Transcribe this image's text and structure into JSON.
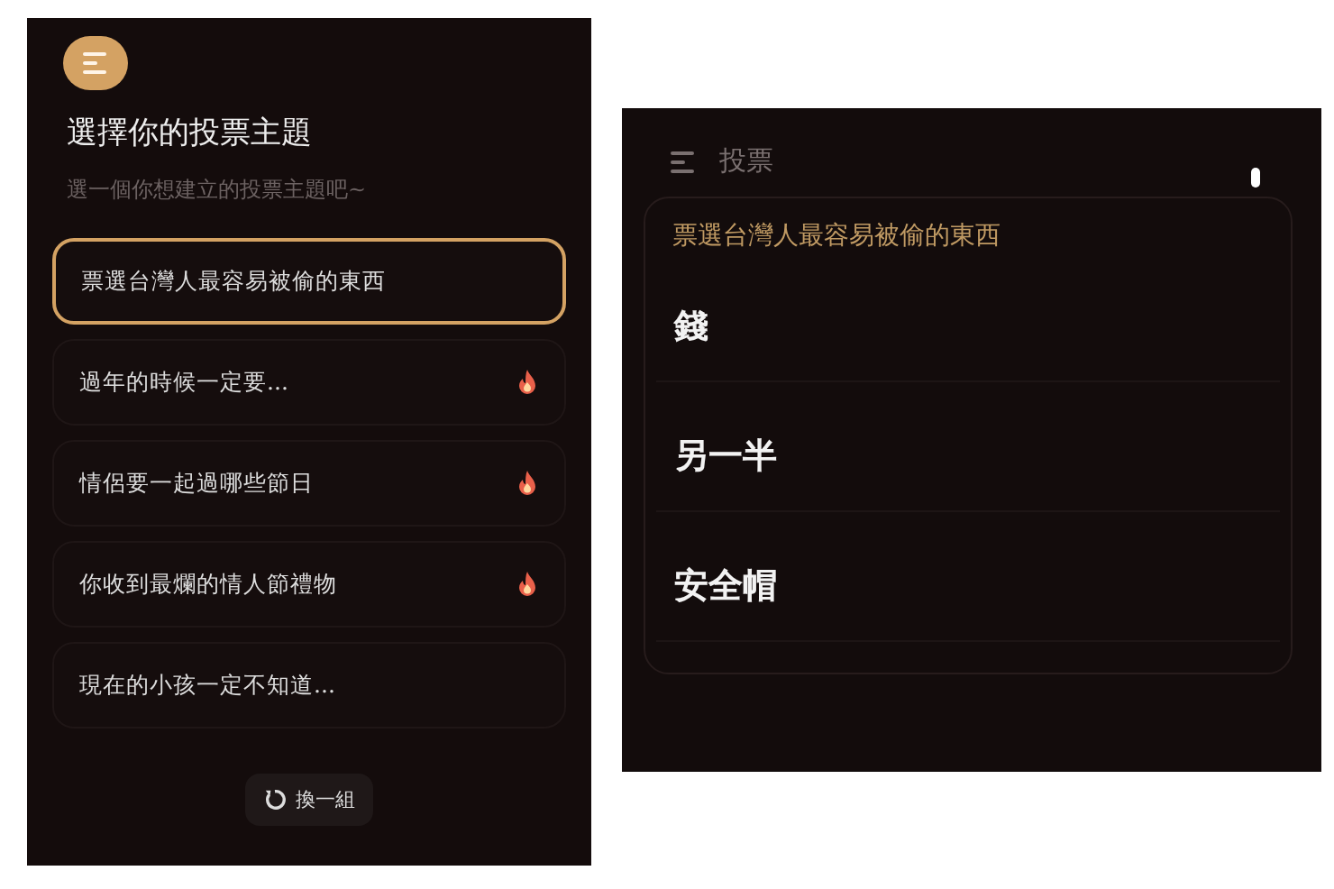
{
  "topic_picker": {
    "title": "選擇你的投票主題",
    "subtitle": "選一個你想建立的投票主題吧~",
    "topics": [
      {
        "label": "票選台灣人最容易被偷的東西",
        "selected": true,
        "hot": false
      },
      {
        "label": "過年的時候一定要...",
        "selected": false,
        "hot": true
      },
      {
        "label": "情侶要一起過哪些節日",
        "selected": false,
        "hot": true
      },
      {
        "label": "你收到最爛的情人節禮物",
        "selected": false,
        "hot": true
      },
      {
        "label": "現在的小孩一定不知道...",
        "selected": false,
        "hot": false
      }
    ],
    "shuffle_button": "換一組"
  },
  "poll": {
    "header": "投票",
    "question": "票選台灣人最容易被偷的東西",
    "options": [
      {
        "label": "錢"
      },
      {
        "label": "另一半"
      },
      {
        "label": "安全帽"
      }
    ]
  }
}
